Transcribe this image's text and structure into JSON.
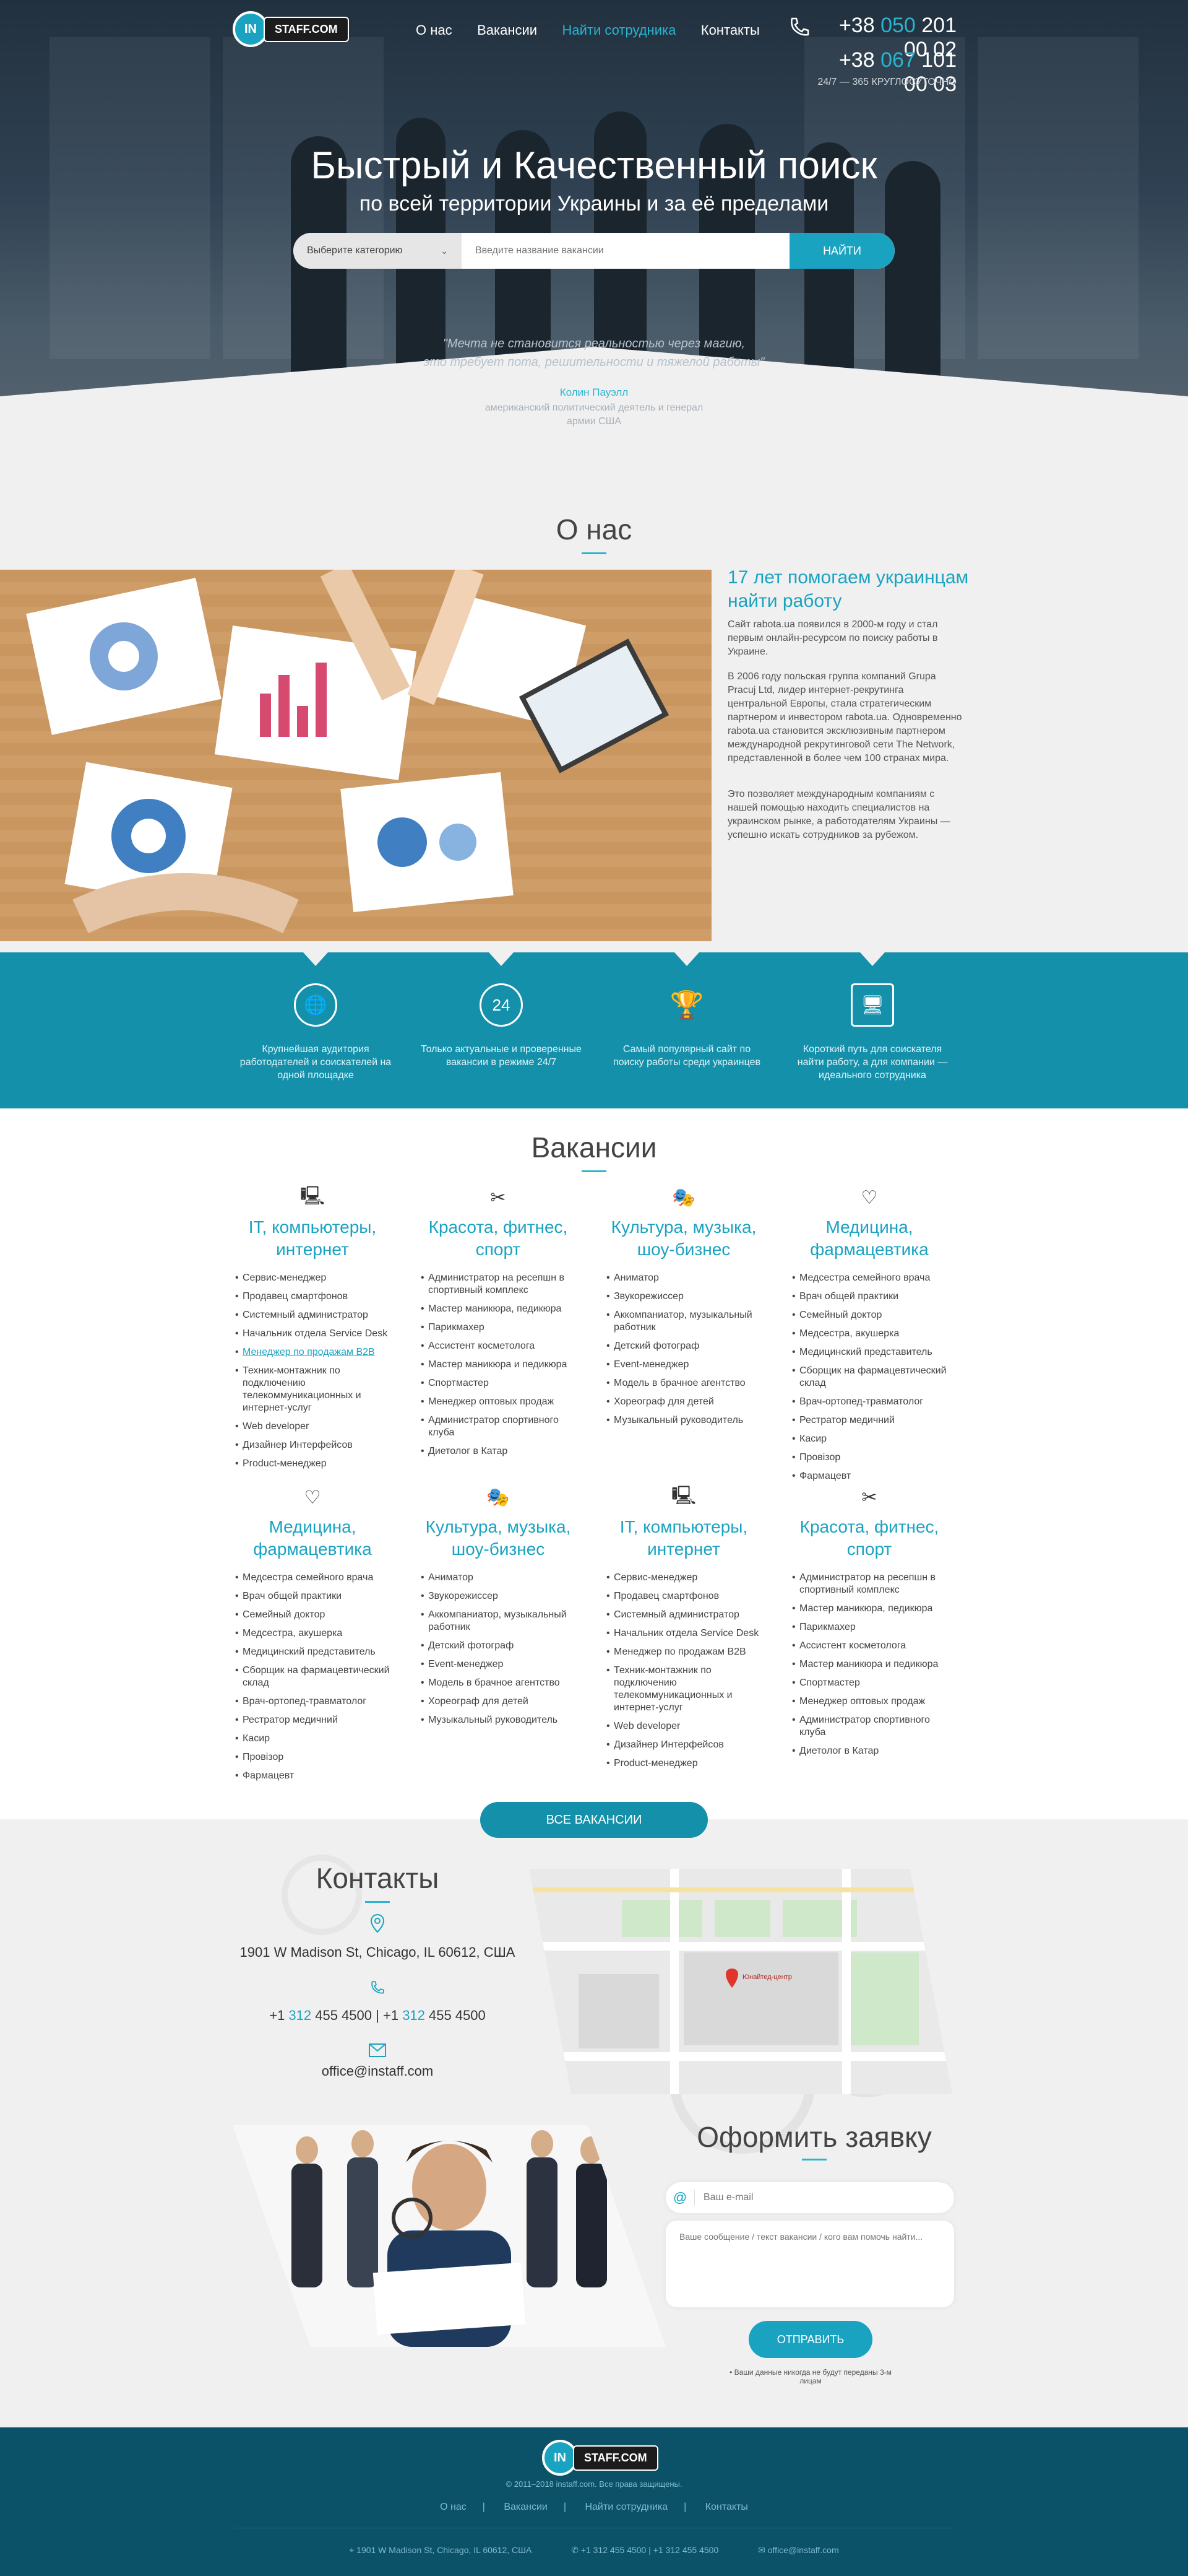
{
  "header": {
    "logo_in": "IN",
    "logo_text": "STAFF.COM",
    "nav": [
      {
        "label": "О нас",
        "active": false
      },
      {
        "label": "Вакансии",
        "active": false
      },
      {
        "label": "Найти сотрудника",
        "active": true
      },
      {
        "label": "Контакты",
        "active": false
      }
    ],
    "phone1_prefix": "+38 ",
    "phone1_code": "050",
    "phone1_rest": " 201 00 02",
    "phone2_prefix": "+38 ",
    "phone2_code": "067",
    "phone2_rest": " 101 00 03",
    "hours": "24/7 — 365 КРУГЛОСУТОЧНО"
  },
  "hero": {
    "title": "Быстрый и Качественный поиск",
    "subtitle": "по всей территории Украины и за её пределами",
    "category_placeholder": "Выберите категорию",
    "search_placeholder": "Введите название вакансии",
    "search_button": "НАЙТИ",
    "quote_line1": "\"Мечта не становится реальностью через магию,",
    "quote_line2": "это требует пота, решительности и тяжелой работы\"",
    "quote_author": "Колин Пауэлл",
    "quote_role1": "американский политический деятель и генерал",
    "quote_role2": "армии США"
  },
  "about": {
    "title": "О нас",
    "heading": "17 лет помогаем украинцам найти работу",
    "p1": "Сайт rabota.ua появился в 2000-м году и стал первым онлайн-ресурсом по поиску работы в Украине.",
    "p2": "В 2006 году польская группа компаний Grupa Pracuj Ltd, лидер интернет-рекрутинга центральной Европы, стала стратегическим партнером и инвестором rabota.ua. Одновременно rabota.ua становится эксклюзивным партнером международной рекрутинговой сети The Network, представленной в более чем 100 странах мира.",
    "p3": "Это позволяет международным компаниям с нашей помощью находить специалистов на украинском рынке, а работодателям Украины — успешно искать сотрудников за рубежом."
  },
  "features": [
    {
      "icon": "globe-hand-icon",
      "text": "Крупнейшая аудитория работодателей и соискателей на одной площадке"
    },
    {
      "icon": "clock-24-icon",
      "text": "Только актуальные и проверенные вакансии в режиме 24/7"
    },
    {
      "icon": "trophy-icon",
      "text": "Самый популярный сайт по поиску работы среди украинцев"
    },
    {
      "icon": "monitor-icon",
      "text": "Короткий путь для соискателя найти работу, а для компании — идеального сотрудника"
    }
  ],
  "vacancies": {
    "title": "Вакансии",
    "all_button": "ВСЕ ВАКАНСИИ",
    "row1": [
      {
        "icon": "computer-icon",
        "glyph": "🖳",
        "title": "IT, компьютеры, интернет",
        "items": [
          "Сервис-менеджер",
          "Продавец смартфонов",
          "Системный администратор",
          "Начальник отдела Service Desk",
          "Менеджер по продажам B2B",
          "Техник-монтажник по подключению телекоммуникационных и интернет-услуг",
          "Web developer",
          "Дизайнер Интерфейсов",
          "Product-менеджер"
        ],
        "link_index": 4
      },
      {
        "icon": "scissors-icon",
        "glyph": "✂",
        "title": "Красота, фитнес, спорт",
        "items": [
          "Администратор на ресепшн в спортивный комплекс",
          "Мастер маникюра, педикюра",
          "Парикмахер",
          "Ассистент косметолога",
          "Мастер маникюра и педикюра",
          "Спортмастер",
          "Менеджер оптовых продаж",
          "Администратор спортивного клуба",
          "Диетолог в Катар"
        ],
        "link_index": -1
      },
      {
        "icon": "masks-icon",
        "glyph": "🎭",
        "title": "Культура, музыка, шоу-бизнес",
        "items": [
          "Аниматор",
          "Звукорежиссер",
          "Аккомпаниатор, музыкальный работник",
          "Детский фотограф",
          "Event-менеджер",
          "Модель в брачное агентство",
          "Хореограф для детей",
          "Музыкальный руководитель"
        ],
        "link_index": -1
      },
      {
        "icon": "heart-pulse-icon",
        "glyph": "♡",
        "title": "Медицина, фармацевтика",
        "items": [
          "Медсестра семейного врача",
          "Врач общей практики",
          "Семейный доктор",
          "Медсестра, акушерка",
          "Медицинский представитель",
          "Сборщик на фармацевтический склад",
          "Врач-ортопед-травматолог",
          "Рестратор медичний",
          "Касир",
          "Провізор",
          "Фармацевт"
        ],
        "link_index": -1
      }
    ],
    "row2": [
      {
        "icon": "heart-pulse-icon",
        "glyph": "♡",
        "title": "Медицина, фармацевтика",
        "items": [
          "Медсестра семейного врача",
          "Врач общей практики",
          "Семейный доктор",
          "Медсестра, акушерка",
          "Медицинский представитель",
          "Сборщик на фармацевтический склад",
          "Врач-ортопед-травматолог",
          "Рестратор медичний",
          "Касир",
          "Провізор",
          "Фармацевт"
        ]
      },
      {
        "icon": "masks-icon",
        "glyph": "🎭",
        "title": "Культура, музыка, шоу-бизнес",
        "items": [
          "Аниматор",
          "Звукорежиссер",
          "Аккомпаниатор, музыкальный работник",
          "Детский фотограф",
          "Event-менеджер",
          "Модель в брачное агентство",
          "Хореограф для детей",
          "Музыкальный руководитель"
        ]
      },
      {
        "icon": "computer-icon",
        "glyph": "🖳",
        "title": "IT, компьютеры, интернет",
        "items": [
          "Сервис-менеджер",
          "Продавец смартфонов",
          "Системный администратор",
          "Начальник отдела Service Desk",
          "Менеджер по продажам B2B",
          "Техник-монтажник по подключению телекоммуникационных и интернет-услуг",
          "Web developer",
          "Дизайнер Интерфейсов",
          "Product-менеджер"
        ]
      },
      {
        "icon": "scissors-icon",
        "glyph": "✂",
        "title": "Красота, фитнес, спорт",
        "items": [
          "Администратор на ресепшн в спортивный комплекс",
          "Мастер маникюра, педикюра",
          "Парикмахер",
          "Ассистент косметолога",
          "Мастер маникюра и педикюра",
          "Спортмастер",
          "Менеджер оптовых продаж",
          "Администратор спортивного клуба",
          "Диетолог в Катар"
        ]
      }
    ]
  },
  "contacts": {
    "title": "Контакты",
    "address": "1901 W Madison St, Chicago, IL 60612, США",
    "phone_a_pre": "+1 ",
    "phone_a_code": "312",
    "phone_a_rest": " 455 4500",
    "sep": "|",
    "phone_b_pre": "+1 ",
    "phone_b_code": "312",
    "phone_b_rest": " 455 4500",
    "email": "office@instaff.com",
    "map_label": "Юнайтед-центр"
  },
  "application": {
    "title": "Оформить заявку",
    "email_placeholder": "Ваш e-mail",
    "message_placeholder": "Ваше сообщение / текст вакансии / кого вам помочь найти...",
    "send_button": "ОТПРАВИТЬ",
    "privacy": "• Ваши данные никогда не будут переданы 3-м лицам"
  },
  "footer": {
    "copyright": "© 2011–2018 instaff.com. Все права защищены.",
    "nav": [
      "О нас",
      "Вакансии",
      "Найти сотрудника",
      "Контакты"
    ],
    "address": "1901 W Madison St, Chicago, IL 60612, США",
    "phones": "+1 312 455 4500 | +1 312 455 4500",
    "email": "office@instaff.com"
  },
  "colors": {
    "accent": "#1aa3c1",
    "band": "#1490ab",
    "footer": "#0b5268"
  }
}
